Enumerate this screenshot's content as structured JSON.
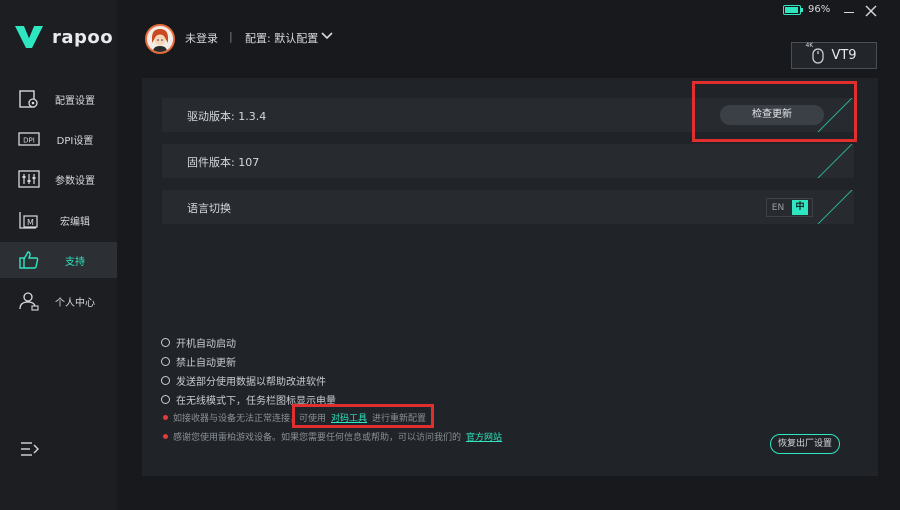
{
  "brand": {
    "name": "rapoo",
    "accent": "#2ee6c0"
  },
  "sidebar": {
    "items": [
      {
        "label": "配置设置",
        "icon": "config-icon"
      },
      {
        "label": "DPI设置",
        "icon": "dpi-icon"
      },
      {
        "label": "参数设置",
        "icon": "sliders-icon"
      },
      {
        "label": "宏编辑",
        "icon": "macro-icon"
      },
      {
        "label": "支持",
        "icon": "thumbs-up-icon",
        "active": true
      },
      {
        "label": "个人中心",
        "icon": "user-icon"
      }
    ],
    "menu_icon": "collapse-menu-icon"
  },
  "header": {
    "user": "未登录",
    "separator": "|",
    "profile": "配置: 默认配置",
    "battery_pct": "96%",
    "battery_level": 0.96,
    "device": {
      "badge": "4K",
      "name": "VT9"
    }
  },
  "support": {
    "driver_version": "驱动版本: 1.3.4",
    "check_update": "检查更新",
    "firmware_version": "固件版本: 107",
    "language_switch": "语言切换",
    "lang_en": "EN",
    "lang_zh": "中",
    "options": [
      "开机自动启动",
      "禁止自动更新",
      "发送部分使用数据以帮助改进软件",
      "在无线模式下，任务栏图标显示电量"
    ],
    "note1_prefix": "如接收器与设备无法正常连接，可使用",
    "note1_link": "对码工具",
    "note1_suffix": "进行重新配置",
    "note2_prefix": "感谢您使用雷柏游戏设备。如果您需要任何信息或帮助，可以访问我们的",
    "note2_link": "官方网站",
    "reset": "恢复出厂设置"
  }
}
